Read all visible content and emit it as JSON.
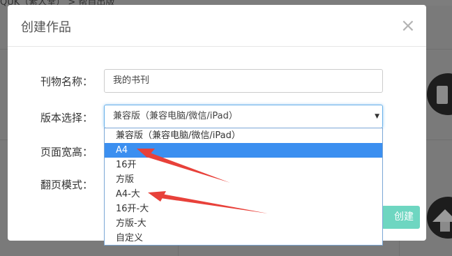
{
  "background": {
    "breadcrumb": "QUK（素人堂） > 帮自出版"
  },
  "modal": {
    "title": "创建作品",
    "close_glyph": "×",
    "fields": {
      "name_label": "刊物名称：",
      "name_value": "我的书刊",
      "version_label": "版本选择：",
      "version_value": "兼容版（兼容电脑/微信/iPad）",
      "size_label": "页面宽高：",
      "flip_label": "翻页模式："
    },
    "create_button": "创建"
  },
  "dropdown": {
    "options": [
      {
        "label": "兼容版（兼容电脑/微信/iPad）",
        "selected": false
      },
      {
        "label": "A4",
        "selected": true
      },
      {
        "label": "16开",
        "selected": false
      },
      {
        "label": "方版",
        "selected": false
      },
      {
        "label": "A4-大",
        "selected": false
      },
      {
        "label": "16开-大",
        "selected": false
      },
      {
        "label": "方版-大",
        "selected": false
      },
      {
        "label": "自定义",
        "selected": false
      }
    ]
  },
  "colors": {
    "accent": "#3b8ff0",
    "button": "#6ed6c1",
    "annotation_arrow": "#e8413a"
  },
  "icons": {
    "close": "close-icon",
    "caret": "caret-down-icon"
  }
}
